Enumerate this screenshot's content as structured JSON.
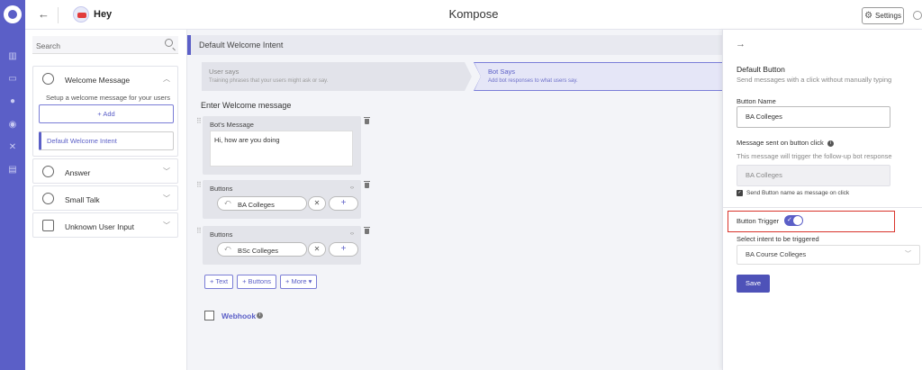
{
  "rail": {
    "icons": [
      "logo-icon",
      "analytics-icon",
      "messages-icon",
      "users-icon",
      "bot-icon",
      "integrations-icon",
      "docs-icon"
    ]
  },
  "topbar": {
    "bot_name": "Hey",
    "title": "Kompose",
    "settings_label": "Settings"
  },
  "sidebar": {
    "search_placeholder": "Search",
    "sections": [
      {
        "label": "Welcome Message",
        "description": "Setup a welcome message for your users",
        "add_label": "+ Add",
        "item": "Default Welcome Intent"
      },
      {
        "label": "Answer"
      },
      {
        "label": "Small Talk"
      },
      {
        "label": "Unknown User Input"
      }
    ]
  },
  "main": {
    "intent_title": "Default Welcome Intent",
    "steps": [
      {
        "title": "User says",
        "desc": "Training phrases that your users might ask or say."
      },
      {
        "title": "Bot Says",
        "desc": "Add bot responses to what users say."
      }
    ],
    "section_title": "Enter Welcome message",
    "bot_message": {
      "label": "Bot's Message",
      "text": "Hi, how are you doing"
    },
    "button_blocks": [
      {
        "label": "Buttons",
        "button": "BA Colleges"
      },
      {
        "label": "Buttons",
        "button": "BSc Colleges"
      }
    ],
    "add_actions": [
      "+ Text",
      "+ Buttons",
      "+ More ▾"
    ],
    "webhook_label": "Webhook"
  },
  "panel": {
    "title": "Default Button",
    "subtitle": "Send messages with a click without manually typing",
    "button_name_label": "Button Name",
    "button_name_value": "BA Colleges",
    "message_label": "Message sent on button click",
    "message_help": "This message will trigger the follow-up bot response",
    "message_value": "BA Colleges",
    "send_checkbox_label": "Send Button name as message on click",
    "send_checked": true,
    "trigger_label": "Button Trigger",
    "trigger_on": true,
    "intent_select_label": "Select intent to be triggered",
    "intent_selected": "BA Course Colleges",
    "save_label": "Save"
  }
}
